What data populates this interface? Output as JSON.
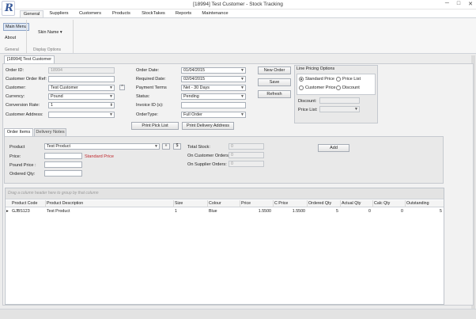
{
  "window": {
    "title": "[18994] Test Customer - Stock Tracking",
    "app_icon_glyph": "R",
    "controls": {
      "minimize": "─",
      "maximize": "□",
      "close": "✕"
    }
  },
  "ribbon": {
    "tabs": [
      "General",
      "Suppliers",
      "Customers",
      "Products",
      "StockTakes",
      "Reports",
      "Maintenance"
    ],
    "active_tab": "General",
    "main_menu_label": "Main Menu",
    "about_label": "About",
    "skin_name_label": "Skin Name ▾",
    "groups": {
      "general": "General",
      "display_options": "Display Options"
    }
  },
  "document": {
    "tab_label": "[18994] Test Customer"
  },
  "order": {
    "labels": {
      "order_id": "Order ID:",
      "customer_order_ref": "Customer Order Ref:",
      "customer": "Customer:",
      "currency": "Currency:",
      "conversion_rate": "Conversion Rate:",
      "customer_address": "Customer Address:",
      "order_date": "Order Date:",
      "required_date": "Required Date:",
      "payment_terms": "Payment Terms",
      "status": "Status:",
      "invoice_id": "Invoice ID (s):",
      "order_type": "OrderType:"
    },
    "values": {
      "order_id": "18994",
      "customer_order_ref": "",
      "customer": "Test Customer",
      "currency": "Pound",
      "conversion_rate": "1",
      "customer_address": "",
      "order_date": "01/04/2015",
      "required_date": "02/04/2015",
      "payment_terms": "Net - 30 Days",
      "status": "Pending",
      "invoice_id": "",
      "order_type": "Full Order"
    },
    "buttons": {
      "new_order": "New Order",
      "save": "Save",
      "refresh": "Refresh",
      "print_pick_list": "Print Pick List",
      "print_delivery_address": "Print Delivery Address"
    }
  },
  "line_pricing": {
    "title": "Line Pricing Options",
    "options": {
      "standard_price": "Standard Price",
      "price_list": "Price List",
      "customer_price": "Customer Price",
      "discount": "Discount"
    },
    "selected": "standard_price",
    "discount_label": "Discount:",
    "price_list_label": "Price List:"
  },
  "subtabs": [
    "Order Items",
    "Delivery Notes"
  ],
  "items": {
    "labels": {
      "product": "Product",
      "price": "Price:",
      "pound_price": "Pound Price :",
      "ordered_qty": "Ordered Qty:",
      "total_stock": "Total Stock:",
      "on_customer_orders": "On Customer Orders:",
      "on_supplier_orders": "On Supplier Orders:"
    },
    "values": {
      "product": "Test Product",
      "price": "",
      "pound_price": "",
      "ordered_qty": "",
      "total_stock": "0",
      "on_customer_orders": "0",
      "on_supplier_orders": "0"
    },
    "price_type_text": "Standard Price",
    "nav_glyph": "»",
    "currency_glyph": "$",
    "add_button": "Add"
  },
  "grid": {
    "group_hint": "Drag a column header here to group by that column",
    "columns": [
      "Product Code",
      "Product Description",
      "Size",
      "Colour",
      "Price",
      "C Price",
      "Ordered Qty",
      "Actual Qty",
      "Calc Qty",
      "Outstanding"
    ],
    "rows": [
      {
        "indicator": "▸",
        "cells": [
          "GJBS123",
          "Test Product",
          "1",
          "Blue",
          "1.5500",
          "1.5500",
          "5",
          "0",
          "0",
          "5"
        ]
      }
    ]
  }
}
